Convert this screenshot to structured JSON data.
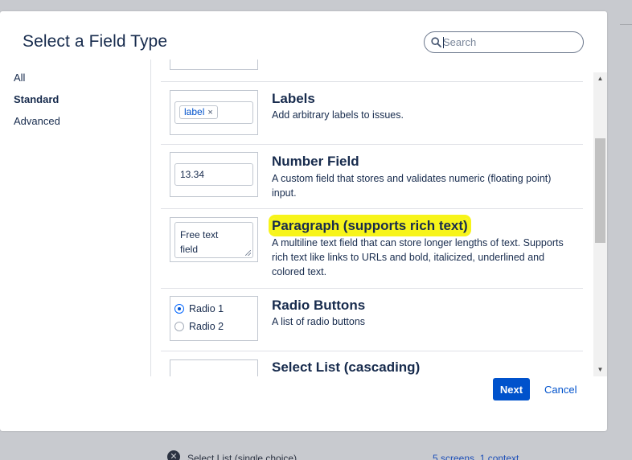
{
  "dialog": {
    "title": "Select a Field Type",
    "search_placeholder": "Search",
    "next_label": "Next",
    "cancel_label": "Cancel"
  },
  "sidebar": {
    "items": [
      {
        "label": "All",
        "active": false
      },
      {
        "label": "Standard",
        "active": true
      },
      {
        "label": "Advanced",
        "active": false
      }
    ]
  },
  "fields": [
    {
      "title": "Labels",
      "description": "Add arbitrary labels to issues.",
      "preview": {
        "lozenge": "label",
        "remove_glyph": "×"
      }
    },
    {
      "title": "Number Field",
      "description": "A custom field that stores and validates numeric (floating point) input.",
      "preview": {
        "value": "13.34"
      }
    },
    {
      "title": "Paragraph (supports rich text)",
      "description": "A multiline text field that can store longer lengths of text. Supports rich text like links to URLs and bold, italicized, underlined and colored text.",
      "highlighted": true,
      "preview": {
        "value_line1": "Free text",
        "value_line2": "field"
      }
    },
    {
      "title": "Radio Buttons",
      "description": "A list of radio buttons",
      "preview": {
        "option1": "Radio 1",
        "option2": "Radio 2",
        "selected": "Radio 1"
      }
    },
    {
      "title": "Select List (cascading)"
    }
  ],
  "background": {
    "row_label": "Select List (single choice)",
    "row_link": "5 screens, 1 context"
  },
  "colors": {
    "primary": "#0052cc",
    "highlight": "#f7f41a",
    "text": "#172b4d",
    "overlay": "#c8cacf"
  },
  "icons": {
    "search": "search-icon",
    "scroll_up": "scroll-up-arrow-icon",
    "scroll_down": "scroll-down-arrow-icon",
    "remove": "close-icon",
    "bg_row": "remove-circle-icon"
  }
}
